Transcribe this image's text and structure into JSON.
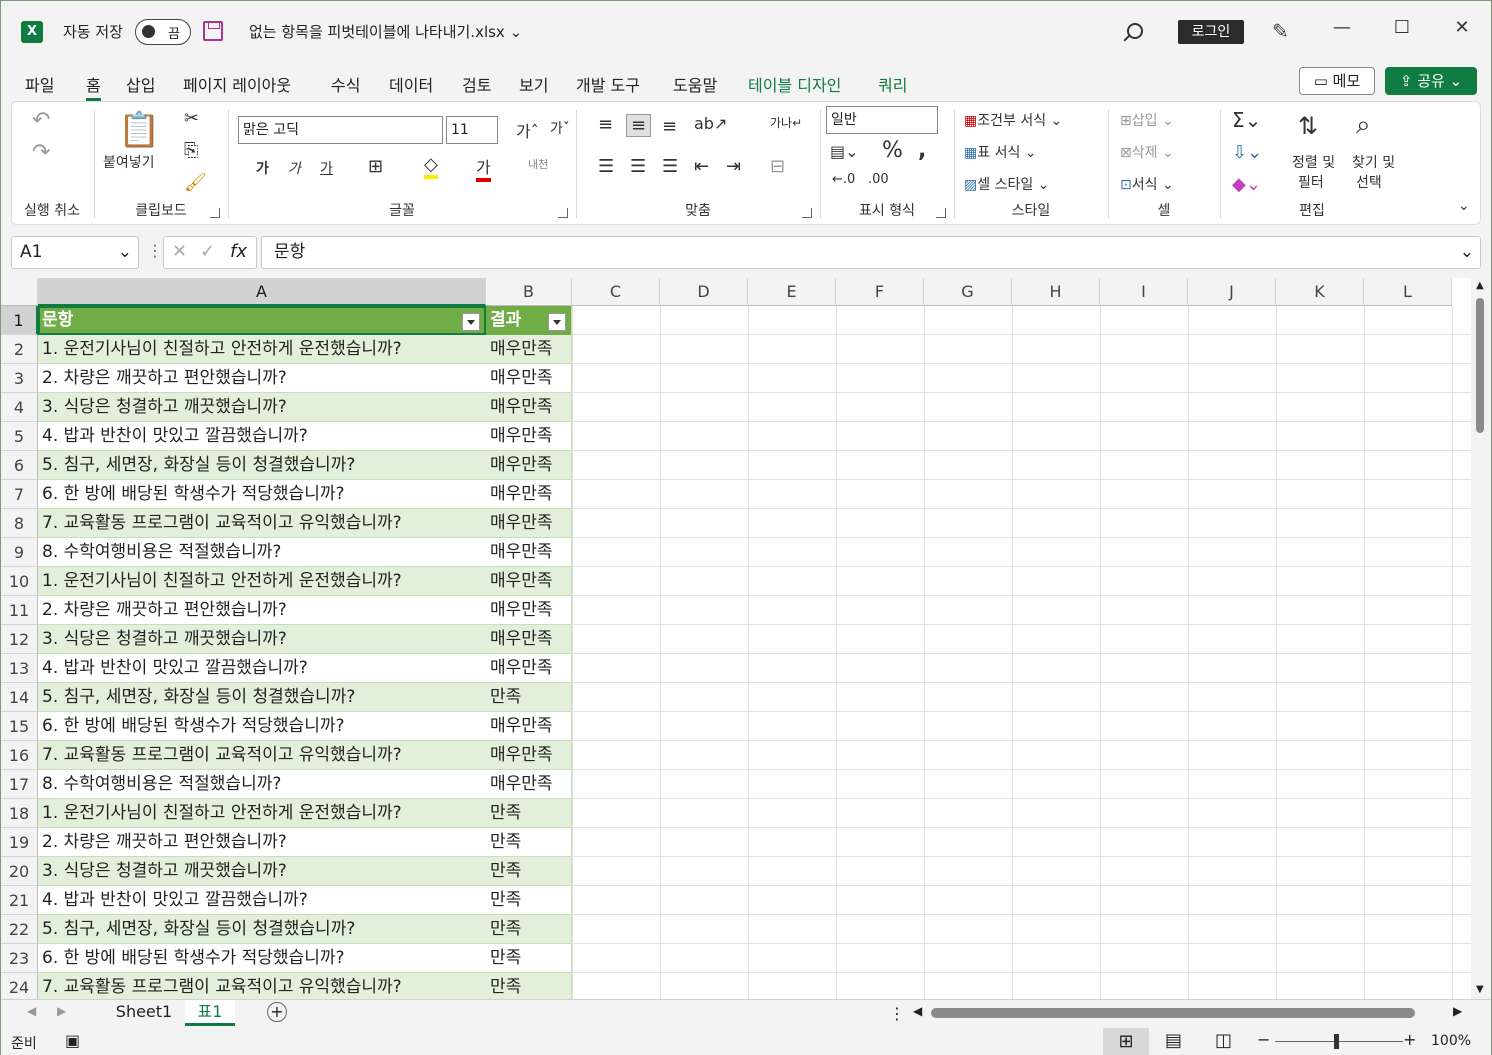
{
  "titlebar": {
    "autosave_label": "자동 저장",
    "autosave_state": "끔",
    "doc_title": "없는 항목을 피벗테이블에 나타내기.xlsx ⌄",
    "login_label": "로그인"
  },
  "menu": {
    "items": [
      "파일",
      "홈",
      "삽입",
      "페이지 레이아웃",
      "수식",
      "데이터",
      "검토",
      "보기",
      "개발 도구",
      "도움말",
      "테이블 디자인",
      "쿼리"
    ],
    "active": "홈",
    "memo_label": "메모",
    "share_label": "공유"
  },
  "ribbon": {
    "undo_group": "실행 취소",
    "clipboard": {
      "paste": "붙여넣기",
      "label": "클립보드"
    },
    "font": {
      "name": "맑은 고딕",
      "size": "11",
      "label": "글꼴"
    },
    "align": {
      "label": "맞춤"
    },
    "number": {
      "format": "일반",
      "label": "표시 형식"
    },
    "styles": {
      "conditional": "조건부 서식",
      "table": "표 서식",
      "cell": "셀 스타일",
      "label": "스타일"
    },
    "cells": {
      "insert": "삽입",
      "delete": "삭제",
      "format": "서식",
      "label": "셀"
    },
    "editing": {
      "sort": "정렬 및",
      "filter": "필터",
      "find": "찾기 및",
      "select": "선택",
      "label": "편집"
    }
  },
  "formula_bar": {
    "name_box": "A1",
    "content": "문항"
  },
  "columns": [
    "A",
    "B",
    "C",
    "D",
    "E",
    "F",
    "G",
    "H",
    "I",
    "J",
    "K",
    "L"
  ],
  "table": {
    "headers": [
      "문항",
      "결과"
    ],
    "rows": [
      [
        "1. 운전기사님이 친절하고 안전하게 운전했습니까?",
        "매우만족"
      ],
      [
        "2. 차량은 깨끗하고 편안했습니까?",
        "매우만족"
      ],
      [
        "3. 식당은 청결하고 깨끗했습니까?",
        "매우만족"
      ],
      [
        "4. 밥과 반찬이 맛있고 깔끔했습니까?",
        "매우만족"
      ],
      [
        "5. 침구, 세면장, 화장실 등이 청결했습니까?",
        "매우만족"
      ],
      [
        "6. 한 방에 배당된 학생수가 적당했습니까?",
        "매우만족"
      ],
      [
        "7. 교육활동 프로그램이 교육적이고 유익했습니까?",
        "매우만족"
      ],
      [
        "8. 수학여행비용은 적절했습니까?",
        "매우만족"
      ],
      [
        "1. 운전기사님이 친절하고 안전하게 운전했습니까?",
        "매우만족"
      ],
      [
        "2. 차량은 깨끗하고 편안했습니까?",
        "매우만족"
      ],
      [
        "3. 식당은 청결하고 깨끗했습니까?",
        "매우만족"
      ],
      [
        "4. 밥과 반찬이 맛있고 깔끔했습니까?",
        "매우만족"
      ],
      [
        "5. 침구, 세면장, 화장실 등이 청결했습니까?",
        "만족"
      ],
      [
        "6. 한 방에 배당된 학생수가 적당했습니까?",
        "매우만족"
      ],
      [
        "7. 교육활동 프로그램이 교육적이고 유익했습니까?",
        "매우만족"
      ],
      [
        "8. 수학여행비용은 적절했습니까?",
        "매우만족"
      ],
      [
        "1. 운전기사님이 친절하고 안전하게 운전했습니까?",
        "만족"
      ],
      [
        "2. 차량은 깨끗하고 편안했습니까?",
        "만족"
      ],
      [
        "3. 식당은 청결하고 깨끗했습니까?",
        "만족"
      ],
      [
        "4. 밥과 반찬이 맛있고 깔끔했습니까?",
        "만족"
      ],
      [
        "5. 침구, 세면장, 화장실 등이 청결했습니까?",
        "만족"
      ],
      [
        "6. 한 방에 배당된 학생수가 적당했습니까?",
        "만족"
      ],
      [
        "7. 교육활동 프로그램이 교육적이고 유익했습니까?",
        "만족"
      ]
    ]
  },
  "sheet_tabs": [
    "Sheet1",
    "표1"
  ],
  "active_sheet": "표1",
  "status": {
    "mode": "준비",
    "zoom": "100%"
  },
  "colors": {
    "accent": "#107c41",
    "table_header": "#70ad47",
    "table_band": "#e2efda"
  }
}
